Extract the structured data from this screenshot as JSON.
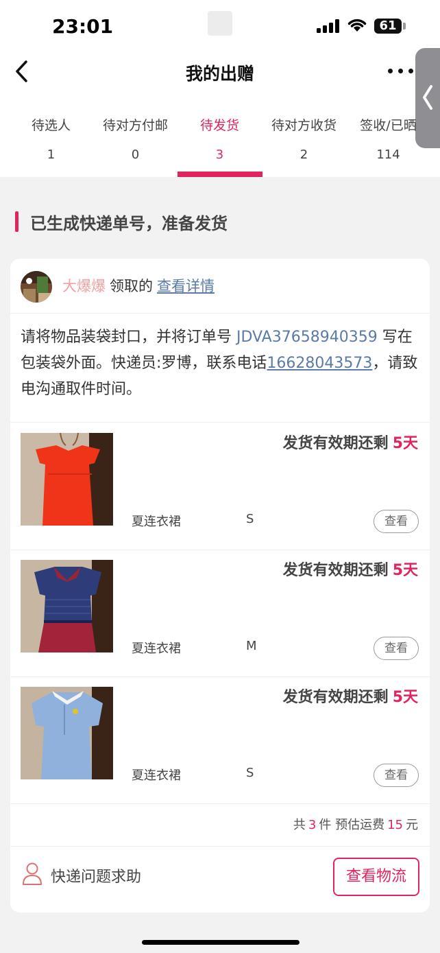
{
  "status_bar": {
    "time": "23:01",
    "battery": "61"
  },
  "nav": {
    "title": "我的出赠"
  },
  "tabs": [
    {
      "label": "待选人",
      "count": "1"
    },
    {
      "label": "待对方付邮",
      "count": "0"
    },
    {
      "label": "待发货",
      "count": "3"
    },
    {
      "label": "待对方收货",
      "count": "2"
    },
    {
      "label": "签收/已晒",
      "count": "114"
    }
  ],
  "active_tab_index": 2,
  "section": {
    "title": "已生成快递单号，准备发货"
  },
  "order": {
    "username": "大爆爆",
    "claimed_text": "领取的",
    "detail_link": "查看详情",
    "instruction_pre": "请将物品装袋封口，并将订单号 ",
    "order_number": "JDVA37658940359",
    "instruction_mid": " 写在包装袋外面。快递员:罗博，联系电话",
    "phone": "16628043573",
    "instruction_post": "，请致电沟通取件时间。"
  },
  "items": [
    {
      "expiry_label": "发货有效期还剩",
      "expiry_days": "5天",
      "name": "夏连衣裙",
      "size": "S",
      "view_label": "查看"
    },
    {
      "expiry_label": "发货有效期还剩",
      "expiry_days": "5天",
      "name": "夏连衣裙",
      "size": "M",
      "view_label": "查看"
    },
    {
      "expiry_label": "发货有效期还剩",
      "expiry_days": "5天",
      "name": "夏连衣裙",
      "size": "S",
      "view_label": "查看"
    }
  ],
  "summary": {
    "prefix": "共",
    "count": "3",
    "count_unit": "件 预估运费",
    "fee": "15",
    "fee_unit": "元"
  },
  "footer": {
    "help_label": "快递问题求助",
    "logistics_label": "查看物流"
  },
  "colors": {
    "accent": "#e0245e",
    "link": "#5a7aa8",
    "username": "#f0a0a0"
  },
  "icons": [
    "back-icon",
    "more-icon",
    "user-outline-icon",
    "side-handle-chevron-icon"
  ]
}
